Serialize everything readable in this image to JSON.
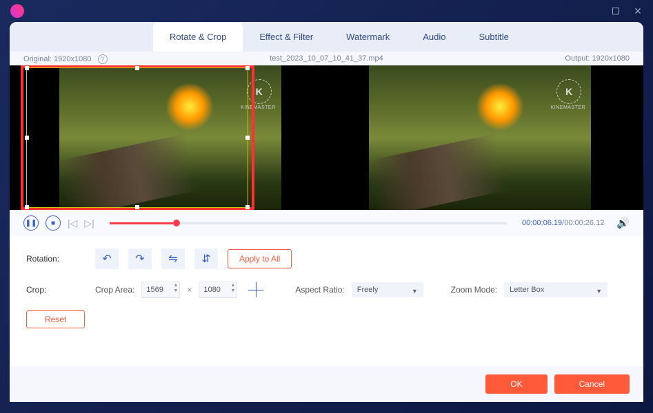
{
  "tabs": {
    "rotate_crop": "Rotate & Crop",
    "effect_filter": "Effect & Filter",
    "watermark": "Watermark",
    "audio": "Audio",
    "subtitle": "Subtitle"
  },
  "info": {
    "original_label": "Original:",
    "original_res": "1920x1080",
    "filename": "test_2023_10_07_10_41_37.mp4",
    "output_label": "Output:",
    "output_res": "1920x1080"
  },
  "watermark_text": "KINEMASTER",
  "watermark_k": "K",
  "playback": {
    "current": "00:00:06.19",
    "total": "/00:00:26.12"
  },
  "rotation": {
    "label": "Rotation:",
    "apply_all": "Apply to All"
  },
  "crop": {
    "label": "Crop:",
    "area_label": "Crop Area:",
    "width": "1569",
    "height": "1080",
    "aspect_label": "Aspect Ratio:",
    "aspect_value": "Freely",
    "zoom_label": "Zoom Mode:",
    "zoom_value": "Letter Box"
  },
  "reset": "Reset",
  "footer": {
    "ok": "OK",
    "cancel": "Cancel"
  }
}
